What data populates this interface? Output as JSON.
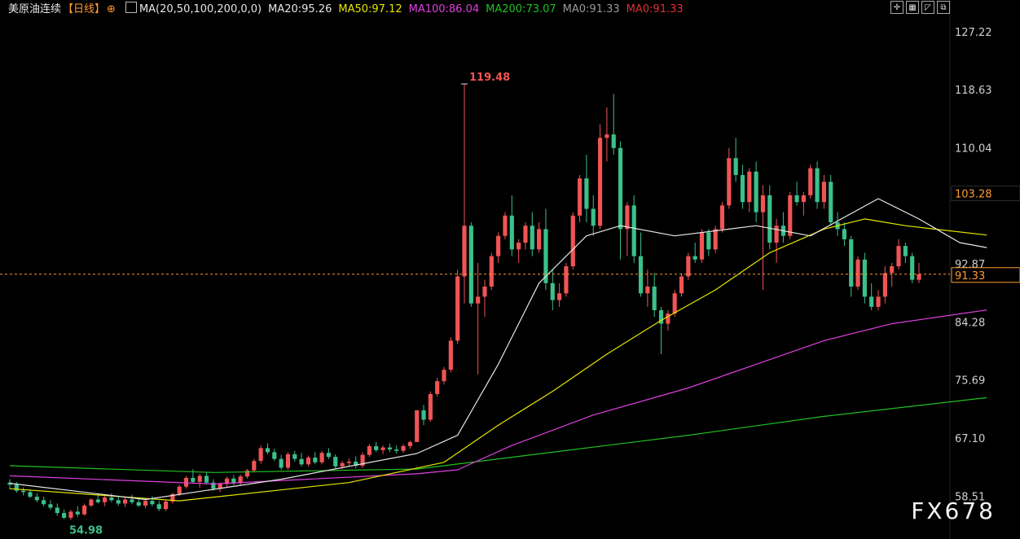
{
  "header": {
    "instrument": "美原油连续",
    "timeframe": "【日线】",
    "timeframe_icon": "crosshair-circle-icon",
    "ma_params": "MA(20,50,100,200,0,0)",
    "indicators": [
      {
        "label": "MA20:95.26",
        "color": "#e6e6e6"
      },
      {
        "label": "MA50:97.12",
        "color": "#e6e600"
      },
      {
        "label": "MA100:86.04",
        "color": "#e040e0"
      },
      {
        "label": "MA200:73.07",
        "color": "#20c020"
      },
      {
        "label": "MA0:91.33",
        "color": "#9a9a9a"
      },
      {
        "label": "MA0:91.33",
        "color": "#e03030"
      }
    ]
  },
  "toolbar": {
    "icons": [
      "crosshair-toolbar-icon",
      "grid-toolbar-icon",
      "chart-toolbar-icon",
      "zoom-toolbar-icon"
    ]
  },
  "watermark": "FX678",
  "chart_data": {
    "type": "candlestick",
    "y_axis": {
      "side": "right",
      "range": [
        53.0,
        129.0
      ],
      "ticks": [
        "127.22",
        "118.63",
        "110.04",
        "103.28",
        "92.87",
        "84.28",
        "75.69",
        "67.10",
        "58.51"
      ]
    },
    "current_price": "91.33",
    "highlight_level": "103.28",
    "annotations": {
      "high": "119.48",
      "low": "54.98"
    },
    "colors": {
      "up": "#f05454",
      "down": "#3cc08a",
      "ma20": "#e6e6e6",
      "ma50": "#e6e600",
      "ma100": "#e040e0",
      "ma200": "#20c020",
      "price_line": "#ff9a2e"
    },
    "candles": [
      [
        60.5,
        61.0,
        59.5,
        60.2
      ],
      [
        60.2,
        60.6,
        59.0,
        59.3
      ],
      [
        59.3,
        59.8,
        58.6,
        59.1
      ],
      [
        59.1,
        59.5,
        58.2,
        58.4
      ],
      [
        58.4,
        58.9,
        57.6,
        57.9
      ],
      [
        57.9,
        58.4,
        57.0,
        57.3
      ],
      [
        57.3,
        57.9,
        56.5,
        56.8
      ],
      [
        56.8,
        57.4,
        55.6,
        56.0
      ],
      [
        56.0,
        56.5,
        55.1,
        55.3
      ],
      [
        55.3,
        56.5,
        54.98,
        56.2
      ],
      [
        56.2,
        57.0,
        55.4,
        55.8
      ],
      [
        55.8,
        57.4,
        55.6,
        57.1
      ],
      [
        57.1,
        58.2,
        56.9,
        58.0
      ],
      [
        58.0,
        58.8,
        57.4,
        57.6
      ],
      [
        57.6,
        58.6,
        57.0,
        58.3
      ],
      [
        58.3,
        58.9,
        57.6,
        57.9
      ],
      [
        57.9,
        58.4,
        57.1,
        57.4
      ],
      [
        57.4,
        58.3,
        56.9,
        58.0
      ],
      [
        58.0,
        58.7,
        57.3,
        57.6
      ],
      [
        57.6,
        58.1,
        56.9,
        57.1
      ],
      [
        57.1,
        58.0,
        56.7,
        57.8
      ],
      [
        57.8,
        58.5,
        57.0,
        57.3
      ],
      [
        57.3,
        57.8,
        56.3,
        56.6
      ],
      [
        56.6,
        58.0,
        56.3,
        57.7
      ],
      [
        57.7,
        59.0,
        57.4,
        58.8
      ],
      [
        58.8,
        60.2,
        58.5,
        59.9
      ],
      [
        59.9,
        61.5,
        59.6,
        61.2
      ],
      [
        61.2,
        62.5,
        60.3,
        60.6
      ],
      [
        60.6,
        61.8,
        59.7,
        61.5
      ],
      [
        61.5,
        62.0,
        60.2,
        60.5
      ],
      [
        60.5,
        61.0,
        59.3,
        59.6
      ],
      [
        59.6,
        60.5,
        59.1,
        60.3
      ],
      [
        60.3,
        61.4,
        59.9,
        61.1
      ],
      [
        61.1,
        61.6,
        60.1,
        60.4
      ],
      [
        60.4,
        61.7,
        60.1,
        61.4
      ],
      [
        61.4,
        62.5,
        61.1,
        62.3
      ],
      [
        62.3,
        64.0,
        62.0,
        63.7
      ],
      [
        63.7,
        66.0,
        63.3,
        65.6
      ],
      [
        65.6,
        66.3,
        64.7,
        65.0
      ],
      [
        65.0,
        65.5,
        63.7,
        64.0
      ],
      [
        64.0,
        64.6,
        62.4,
        62.7
      ],
      [
        62.7,
        65.0,
        62.4,
        64.7
      ],
      [
        64.7,
        65.2,
        63.6,
        64.0
      ],
      [
        64.0,
        64.9,
        62.9,
        63.2
      ],
      [
        63.2,
        64.5,
        62.9,
        64.2
      ],
      [
        64.2,
        65.0,
        63.2,
        63.5
      ],
      [
        63.5,
        65.2,
        63.2,
        64.9
      ],
      [
        64.9,
        65.6,
        64.0,
        64.3
      ],
      [
        64.3,
        64.7,
        62.6,
        62.9
      ],
      [
        62.9,
        63.7,
        62.5,
        63.4
      ],
      [
        63.4,
        64.1,
        62.9,
        63.6
      ],
      [
        63.6,
        64.4,
        62.6,
        63.0
      ],
      [
        63.0,
        65.0,
        62.7,
        64.6
      ],
      [
        64.6,
        66.2,
        64.3,
        65.9
      ],
      [
        65.9,
        66.5,
        65.0,
        65.3
      ],
      [
        65.3,
        66.0,
        64.7,
        65.7
      ],
      [
        65.7,
        66.3,
        65.0,
        65.4
      ],
      [
        65.4,
        66.0,
        64.8,
        65.2
      ],
      [
        65.2,
        66.2,
        64.9,
        65.9
      ],
      [
        65.9,
        66.7,
        65.5,
        66.5
      ],
      [
        66.5,
        67.5,
        69.0,
        71.2
      ],
      [
        71.2,
        72.0,
        69.0,
        69.8
      ],
      [
        69.8,
        74.0,
        69.5,
        73.6
      ],
      [
        73.6,
        76.0,
        73.2,
        75.5
      ],
      [
        75.5,
        77.6,
        75.0,
        77.2
      ],
      [
        77.2,
        82.0,
        76.8,
        81.5
      ],
      [
        81.5,
        92.0,
        81.0,
        91.0
      ],
      [
        91.0,
        119.48,
        87.0,
        98.5
      ],
      [
        98.5,
        99.0,
        86.5,
        87.0
      ],
      [
        87.0,
        93.0,
        76.5,
        88.0
      ],
      [
        88.0,
        90.5,
        85.0,
        89.5
      ],
      [
        89.5,
        94.5,
        89.0,
        94.0
      ],
      [
        94.0,
        97.5,
        93.0,
        97.0
      ],
      [
        97.0,
        100.5,
        96.5,
        100.0
      ],
      [
        100.0,
        103.0,
        94.0,
        95.0
      ],
      [
        95.0,
        96.5,
        93.0,
        96.0
      ],
      [
        96.0,
        99.0,
        95.0,
        98.5
      ],
      [
        98.5,
        100.5,
        94.0,
        95.0
      ],
      [
        95.0,
        99.0,
        94.5,
        98.0
      ],
      [
        98.0,
        101.0,
        89.0,
        90.0
      ],
      [
        90.0,
        92.0,
        86.0,
        87.5
      ],
      [
        87.5,
        90.0,
        86.5,
        88.5
      ],
      [
        88.5,
        93.0,
        88.0,
        92.5
      ],
      [
        92.5,
        100.5,
        92.0,
        100.0
      ],
      [
        100.0,
        106.0,
        99.0,
        105.5
      ],
      [
        105.5,
        109.0,
        99.0,
        101.0
      ],
      [
        101.0,
        103.0,
        97.0,
        98.5
      ],
      [
        98.5,
        113.5,
        98.0,
        111.5
      ],
      [
        111.5,
        116.0,
        108.0,
        112.0
      ],
      [
        112.0,
        118.0,
        109.0,
        110.0
      ],
      [
        110.0,
        111.0,
        93.5,
        98.0
      ],
      [
        98.0,
        102.0,
        94.0,
        101.5
      ],
      [
        101.5,
        103.0,
        93.0,
        94.0
      ],
      [
        94.0,
        97.5,
        88.0,
        88.5
      ],
      [
        88.5,
        92.0,
        86.5,
        89.5
      ],
      [
        89.5,
        91.5,
        85.0,
        86.0
      ],
      [
        86.0,
        86.5,
        79.5,
        84.0
      ],
      [
        84.0,
        86.0,
        83.0,
        85.5
      ],
      [
        85.5,
        89.0,
        85.0,
        88.5
      ],
      [
        88.5,
        91.5,
        88.0,
        91.0
      ],
      [
        91.0,
        94.5,
        90.5,
        94.0
      ],
      [
        94.0,
        96.0,
        93.0,
        93.5
      ],
      [
        93.5,
        98.0,
        93.0,
        97.5
      ],
      [
        97.5,
        98.0,
        94.0,
        95.0
      ],
      [
        95.0,
        98.5,
        94.5,
        98.0
      ],
      [
        98.0,
        102.0,
        97.5,
        101.5
      ],
      [
        101.5,
        110.0,
        101.0,
        108.5
      ],
      [
        108.5,
        111.5,
        105.0,
        106.0
      ],
      [
        106.0,
        107.5,
        101.0,
        102.0
      ],
      [
        102.0,
        107.0,
        100.5,
        106.5
      ],
      [
        106.5,
        108.0,
        99.0,
        100.5
      ],
      [
        100.5,
        104.5,
        89.0,
        103.0
      ],
      [
        103.0,
        104.5,
        95.0,
        96.0
      ],
      [
        96.0,
        99.5,
        93.0,
        98.5
      ],
      [
        98.5,
        100.5,
        96.0,
        97.0
      ],
      [
        97.0,
        103.5,
        96.5,
        103.0
      ],
      [
        103.0,
        105.0,
        101.5,
        102.0
      ],
      [
        102.0,
        103.5,
        100.0,
        103.0
      ],
      [
        103.0,
        107.5,
        102.5,
        107.0
      ],
      [
        107.0,
        108.0,
        101.0,
        102.0
      ],
      [
        102.0,
        106.0,
        101.0,
        105.0
      ],
      [
        105.0,
        106.0,
        98.5,
        99.0
      ],
      [
        99.0,
        100.5,
        97.0,
        98.0
      ],
      [
        98.0,
        99.0,
        95.5,
        96.5
      ],
      [
        96.5,
        97.0,
        88.0,
        89.5
      ],
      [
        89.5,
        94.0,
        89.0,
        93.5
      ],
      [
        93.5,
        94.5,
        87.0,
        88.0
      ],
      [
        88.0,
        90.0,
        86.0,
        86.5
      ],
      [
        86.5,
        89.0,
        86.0,
        88.0
      ],
      [
        88.0,
        92.5,
        87.0,
        91.5
      ],
      [
        91.5,
        93.0,
        89.5,
        92.5
      ],
      [
        92.5,
        96.5,
        92.0,
        95.5
      ],
      [
        95.5,
        96.0,
        93.0,
        94.0
      ],
      [
        94.0,
        94.5,
        90.0,
        90.5
      ],
      [
        90.5,
        93.0,
        90.0,
        91.33
      ]
    ],
    "ma20": [
      [
        0,
        60.4
      ],
      [
        20,
        58.0
      ],
      [
        40,
        61.0
      ],
      [
        60,
        64.8
      ],
      [
        66,
        67.5
      ],
      [
        72,
        78.0
      ],
      [
        78,
        90.0
      ],
      [
        85,
        97.0
      ],
      [
        90,
        98.5
      ],
      [
        98,
        97.0
      ],
      [
        110,
        98.5
      ],
      [
        118,
        97.0
      ],
      [
        128,
        102.5
      ],
      [
        134,
        99.5
      ],
      [
        140,
        96.0
      ],
      [
        144,
        95.26
      ]
    ],
    "ma50": [
      [
        0,
        59.6
      ],
      [
        25,
        57.8
      ],
      [
        50,
        60.5
      ],
      [
        64,
        63.5
      ],
      [
        72,
        69.0
      ],
      [
        80,
        74.0
      ],
      [
        88,
        79.5
      ],
      [
        96,
        84.5
      ],
      [
        104,
        89.0
      ],
      [
        112,
        94.5
      ],
      [
        120,
        98.0
      ],
      [
        126,
        99.5
      ],
      [
        132,
        98.5
      ],
      [
        144,
        97.12
      ]
    ],
    "ma100": [
      [
        0,
        61.5
      ],
      [
        30,
        60.3
      ],
      [
        60,
        61.8
      ],
      [
        66,
        62.4
      ],
      [
        74,
        66.0
      ],
      [
        86,
        70.5
      ],
      [
        100,
        74.5
      ],
      [
        110,
        78.0
      ],
      [
        120,
        81.5
      ],
      [
        130,
        84.0
      ],
      [
        144,
        86.04
      ]
    ],
    "ma200": [
      [
        0,
        63.0
      ],
      [
        30,
        62.0
      ],
      [
        60,
        62.5
      ],
      [
        80,
        65.0
      ],
      [
        100,
        67.5
      ],
      [
        120,
        70.3
      ],
      [
        144,
        73.07
      ]
    ]
  }
}
